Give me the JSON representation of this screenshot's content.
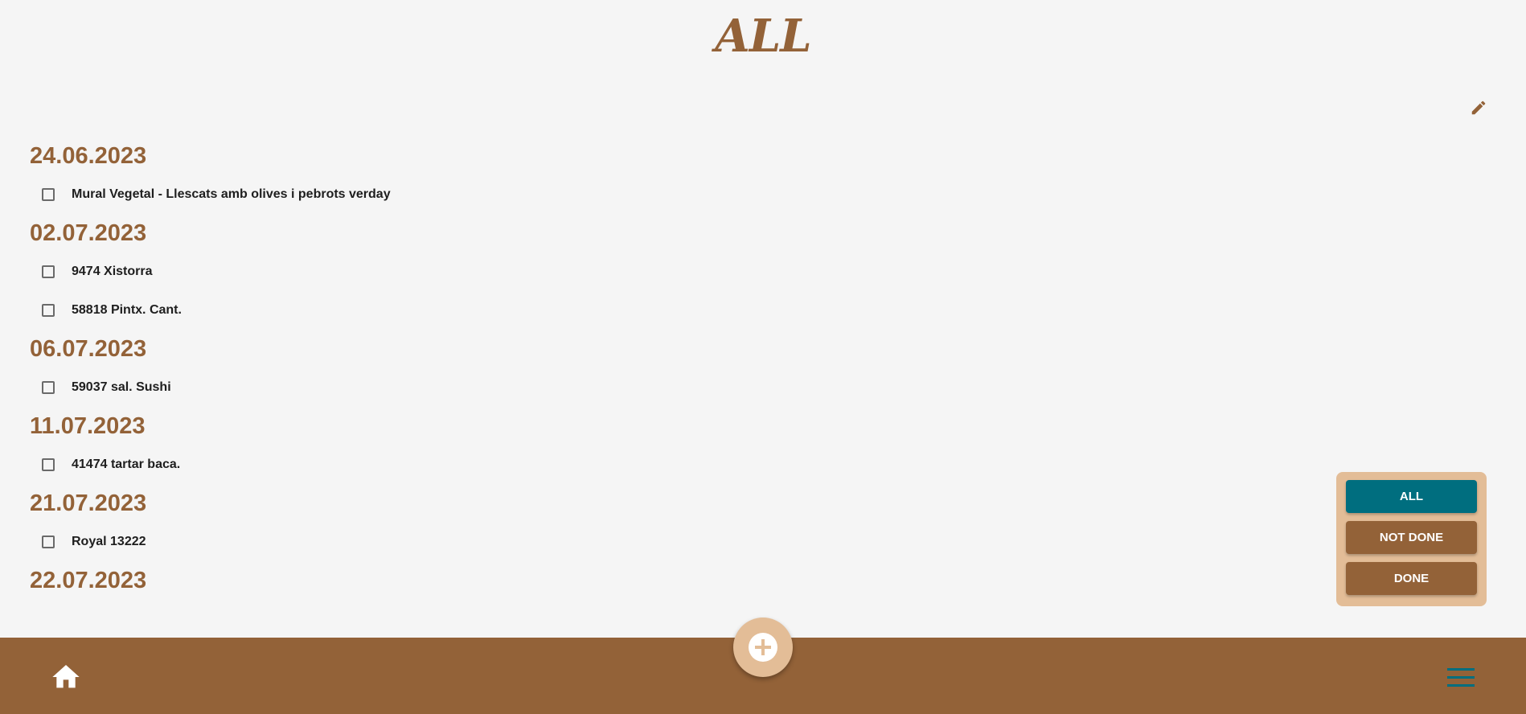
{
  "header": {
    "title": "ALL"
  },
  "icons": {
    "edit": "pencil-icon",
    "add": "plus-circle-icon",
    "home": "home-icon",
    "menu": "hamburger-menu-icon"
  },
  "colors": {
    "brand_brown": "#936238",
    "light_tan": "#e3bd97",
    "active_teal": "#006e7f",
    "background": "#f5f5f5"
  },
  "groups": [
    {
      "date": "24.06.2023",
      "items": [
        {
          "label": "Mural Vegetal - Llescats amb olives i pebrots verday",
          "done": false
        }
      ]
    },
    {
      "date": "02.07.2023",
      "items": [
        {
          "label": "9474 Xistorra",
          "done": false
        },
        {
          "label": "58818 Pintx. Cant.",
          "done": false
        }
      ]
    },
    {
      "date": "06.07.2023",
      "items": [
        {
          "label": "59037 sal. Sushi",
          "done": false
        }
      ]
    },
    {
      "date": "11.07.2023",
      "items": [
        {
          "label": "41474 tartar baca.",
          "done": false
        }
      ]
    },
    {
      "date": "21.07.2023",
      "items": [
        {
          "label": "Royal 13222",
          "done": false
        }
      ]
    },
    {
      "date": "22.07.2023",
      "items": []
    }
  ],
  "filters": {
    "selected": "ALL",
    "options": [
      {
        "label": "ALL",
        "active": true
      },
      {
        "label": "NOT DONE",
        "active": false
      },
      {
        "label": "DONE",
        "active": false
      }
    ]
  }
}
